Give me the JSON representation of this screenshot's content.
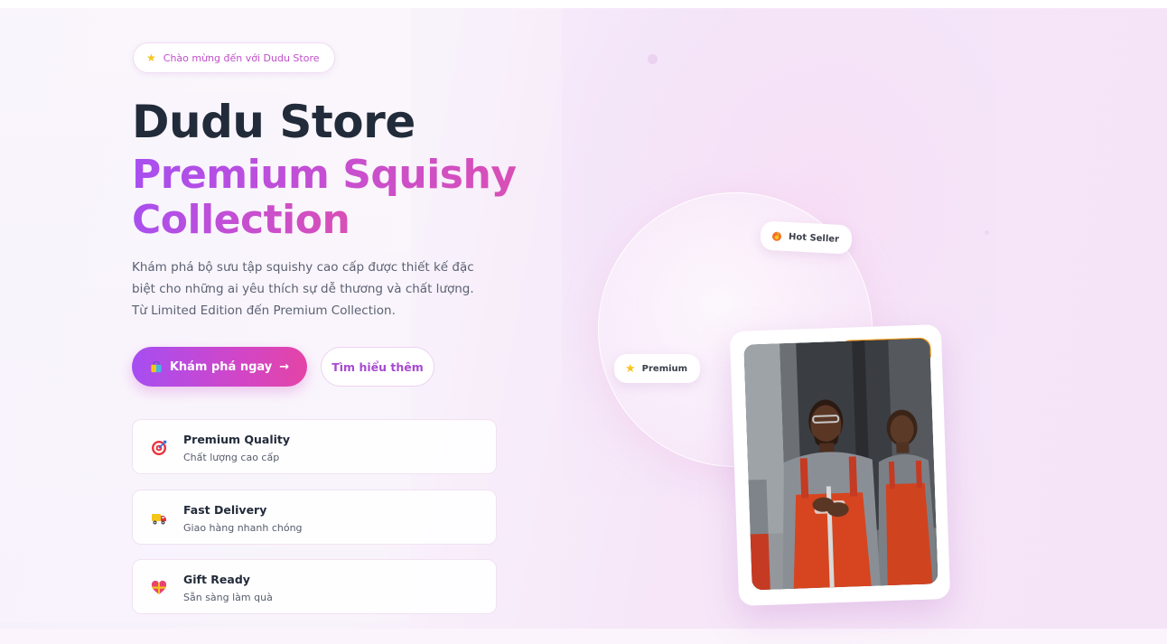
{
  "welcome_badge": {
    "icon": "star-icon",
    "text": "Chào mừng đến với Dudu Store"
  },
  "hero": {
    "title_line1": "Dudu Store",
    "title_line2": "Premium Squishy",
    "title_line3": "Collection",
    "description_lines": [
      "Khám phá bộ sưu tập squishy cao cấp được thiết kế đặc",
      "biệt cho những ai yêu thích sự dễ thương và chất lượng.",
      "Từ Limited Edition đến Premium Collection."
    ]
  },
  "buttons": {
    "primary": {
      "icon": "shopping-bag-icon",
      "label": "Khám phá ngay",
      "trailing_icon": "arrow-right-icon"
    },
    "secondary": {
      "label": "Tìm hiểu thêm"
    }
  },
  "features": [
    {
      "icon": "target-icon",
      "title": "Premium Quality",
      "subtitle": "Chất lượng cao cấp"
    },
    {
      "icon": "delivery-truck-icon",
      "title": "Fast Delivery",
      "subtitle": "Giao hàng nhanh chóng"
    },
    {
      "icon": "gift-heart-icon",
      "title": "Gift Ready",
      "subtitle": "Sẵn sàng làm quà"
    }
  ],
  "floating_badges": {
    "hot_seller": {
      "icon": "fire-icon",
      "label": "Hot Seller"
    },
    "premium": {
      "icon": "star-icon",
      "label": "Premium"
    }
  },
  "colors": {
    "brand_gradient_start": "#a84ff0",
    "brand_gradient_end": "#e444a6",
    "title_dark": "#222b3a",
    "badge_text": "#c14fc9",
    "accent_orange": "#f19a1c"
  }
}
